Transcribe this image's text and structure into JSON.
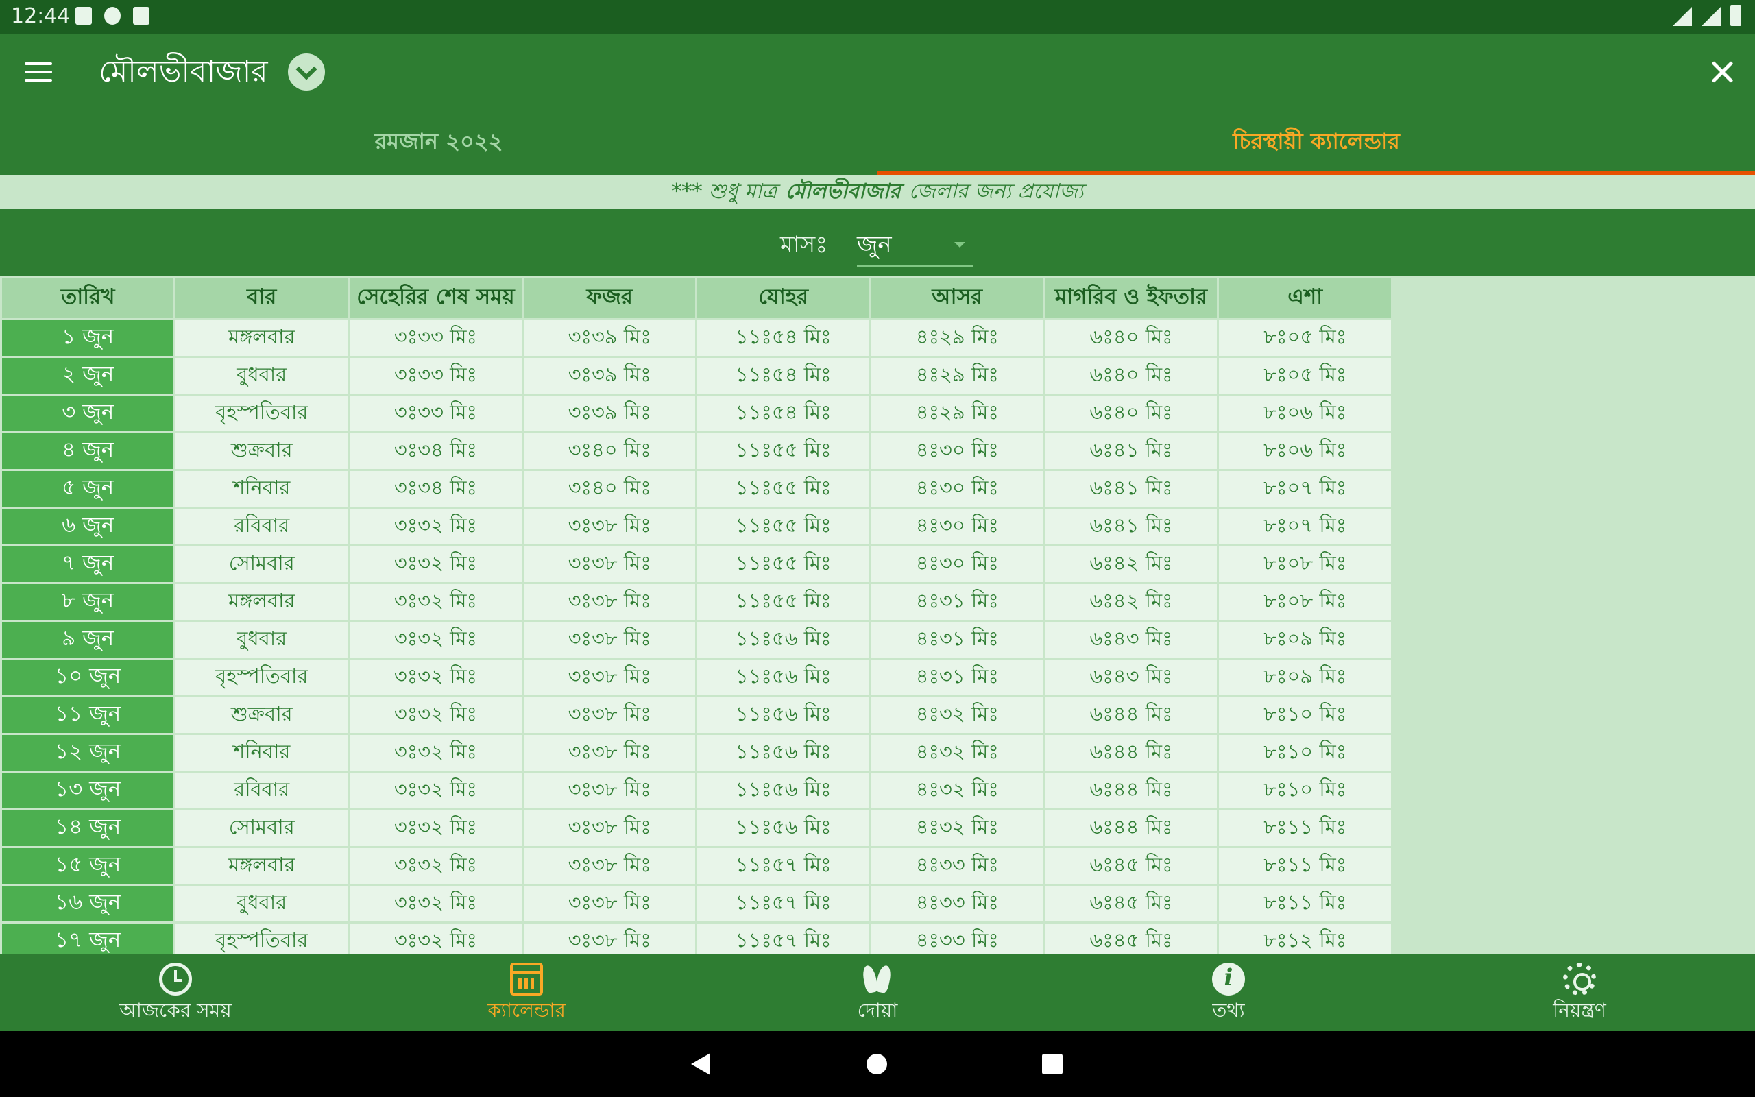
{
  "status": {
    "time": "12:44"
  },
  "app": {
    "title": "মৌলভীবাজার"
  },
  "tabs": [
    {
      "label": "রমজান ২০২২",
      "active": false
    },
    {
      "label": "চিরস্থায়ী ক্যালেন্ডার",
      "active": true
    }
  ],
  "notice": {
    "prefix": "*** শুধু মাত্র",
    "district": "মৌলভীবাজার",
    "suffix": "জেলার জন্য প্রযোজ্য"
  },
  "month": {
    "label": "মাসঃ",
    "value": "জুন"
  },
  "table": {
    "headers": [
      "তারিখ",
      "বার",
      "সেহেরির শেষ সময়",
      "ফজর",
      "যোহর",
      "আসর",
      "মাগরিব ও ইফতার",
      "এশা"
    ],
    "rows": [
      [
        "১ জুন",
        "মঙ্গলবার",
        "৩ঃ৩৩ মিঃ",
        "৩ঃ৩৯ মিঃ",
        "১১ঃ৫৪ মিঃ",
        "৪ঃ২৯ মিঃ",
        "৬ঃ৪০ মিঃ",
        "৮ঃ০৫ মিঃ"
      ],
      [
        "২ জুন",
        "বুধবার",
        "৩ঃ৩৩ মিঃ",
        "৩ঃ৩৯ মিঃ",
        "১১ঃ৫৪ মিঃ",
        "৪ঃ২৯ মিঃ",
        "৬ঃ৪০ মিঃ",
        "৮ঃ০৫ মিঃ"
      ],
      [
        "৩ জুন",
        "বৃহস্পতিবার",
        "৩ঃ৩৩ মিঃ",
        "৩ঃ৩৯ মিঃ",
        "১১ঃ৫৪ মিঃ",
        "৪ঃ২৯ মিঃ",
        "৬ঃ৪০ মিঃ",
        "৮ঃ০৬ মিঃ"
      ],
      [
        "৪ জুন",
        "শুক্রবার",
        "৩ঃ৩৪ মিঃ",
        "৩ঃ৪০ মিঃ",
        "১১ঃ৫৫ মিঃ",
        "৪ঃ৩০ মিঃ",
        "৬ঃ৪১ মিঃ",
        "৮ঃ০৬ মিঃ"
      ],
      [
        "৫ জুন",
        "শনিবার",
        "৩ঃ৩৪ মিঃ",
        "৩ঃ৪০ মিঃ",
        "১১ঃ৫৫ মিঃ",
        "৪ঃ৩০ মিঃ",
        "৬ঃ৪১ মিঃ",
        "৮ঃ০৭ মিঃ"
      ],
      [
        "৬ জুন",
        "রবিবার",
        "৩ঃ৩২ মিঃ",
        "৩ঃ৩৮ মিঃ",
        "১১ঃ৫৫ মিঃ",
        "৪ঃ৩০ মিঃ",
        "৬ঃ৪১ মিঃ",
        "৮ঃ০৭ মিঃ"
      ],
      [
        "৭ জুন",
        "সোমবার",
        "৩ঃ৩২ মিঃ",
        "৩ঃ৩৮ মিঃ",
        "১১ঃ৫৫ মিঃ",
        "৪ঃ৩০ মিঃ",
        "৬ঃ৪২ মিঃ",
        "৮ঃ০৮ মিঃ"
      ],
      [
        "৮ জুন",
        "মঙ্গলবার",
        "৩ঃ৩২ মিঃ",
        "৩ঃ৩৮ মিঃ",
        "১১ঃ৫৫ মিঃ",
        "৪ঃ৩১ মিঃ",
        "৬ঃ৪২ মিঃ",
        "৮ঃ০৮ মিঃ"
      ],
      [
        "৯ জুন",
        "বুধবার",
        "৩ঃ৩২ মিঃ",
        "৩ঃ৩৮ মিঃ",
        "১১ঃ৫৬ মিঃ",
        "৪ঃ৩১ মিঃ",
        "৬ঃ৪৩ মিঃ",
        "৮ঃ০৯ মিঃ"
      ],
      [
        "১০ জুন",
        "বৃহস্পতিবার",
        "৩ঃ৩২ মিঃ",
        "৩ঃ৩৮ মিঃ",
        "১১ঃ৫৬ মিঃ",
        "৪ঃ৩১ মিঃ",
        "৬ঃ৪৩ মিঃ",
        "৮ঃ০৯ মিঃ"
      ],
      [
        "১১ জুন",
        "শুক্রবার",
        "৩ঃ৩২ মিঃ",
        "৩ঃ৩৮ মিঃ",
        "১১ঃ৫৬ মিঃ",
        "৪ঃ৩২ মিঃ",
        "৬ঃ৪৪ মিঃ",
        "৮ঃ১০ মিঃ"
      ],
      [
        "১২ জুন",
        "শনিবার",
        "৩ঃ৩২ মিঃ",
        "৩ঃ৩৮ মিঃ",
        "১১ঃ৫৬ মিঃ",
        "৪ঃ৩২ মিঃ",
        "৬ঃ৪৪ মিঃ",
        "৮ঃ১০ মিঃ"
      ],
      [
        "১৩ জুন",
        "রবিবার",
        "৩ঃ৩২ মিঃ",
        "৩ঃ৩৮ মিঃ",
        "১১ঃ৫৬ মিঃ",
        "৪ঃ৩২ মিঃ",
        "৬ঃ৪৪ মিঃ",
        "৮ঃ১০ মিঃ"
      ],
      [
        "১৪ জুন",
        "সোমবার",
        "৩ঃ৩২ মিঃ",
        "৩ঃ৩৮ মিঃ",
        "১১ঃ৫৬ মিঃ",
        "৪ঃ৩২ মিঃ",
        "৬ঃ৪৪ মিঃ",
        "৮ঃ১১ মিঃ"
      ],
      [
        "১৫ জুন",
        "মঙ্গলবার",
        "৩ঃ৩২ মিঃ",
        "৩ঃ৩৮ মিঃ",
        "১১ঃ৫৭ মিঃ",
        "৪ঃ৩৩ মিঃ",
        "৬ঃ৪৫ মিঃ",
        "৮ঃ১১ মিঃ"
      ],
      [
        "১৬ জুন",
        "বুধবার",
        "৩ঃ৩২ মিঃ",
        "৩ঃ৩৮ মিঃ",
        "১১ঃ৫৭ মিঃ",
        "৪ঃ৩৩ মিঃ",
        "৬ঃ৪৫ মিঃ",
        "৮ঃ১১ মিঃ"
      ],
      [
        "১৭ জুন",
        "বৃহস্পতিবার",
        "৩ঃ৩২ মিঃ",
        "৩ঃ৩৮ মিঃ",
        "১১ঃ৫৭ মিঃ",
        "৪ঃ৩৩ মিঃ",
        "৬ঃ৪৫ মিঃ",
        "৮ঃ১২ মিঃ"
      ]
    ]
  },
  "bottom_nav": [
    {
      "label": "আজকের সময়",
      "icon": "clock-icon",
      "active": false
    },
    {
      "label": "ক্যালেন্ডার",
      "icon": "calendar-icon",
      "active": true
    },
    {
      "label": "দোয়া",
      "icon": "praying-hands-icon",
      "active": false
    },
    {
      "label": "তথ্য",
      "icon": "info-icon",
      "active": false
    },
    {
      "label": "নিয়ন্ত্রণ",
      "icon": "gear-icon",
      "active": false
    }
  ],
  "colors": {
    "primary": "#2e7d32",
    "dark": "#1b5e20",
    "light": "#c8e6c9",
    "header_cell": "#a5d6a7",
    "date_cell": "#4caf50",
    "accent": "#f9a825",
    "tab_indicator": "#e65100"
  }
}
